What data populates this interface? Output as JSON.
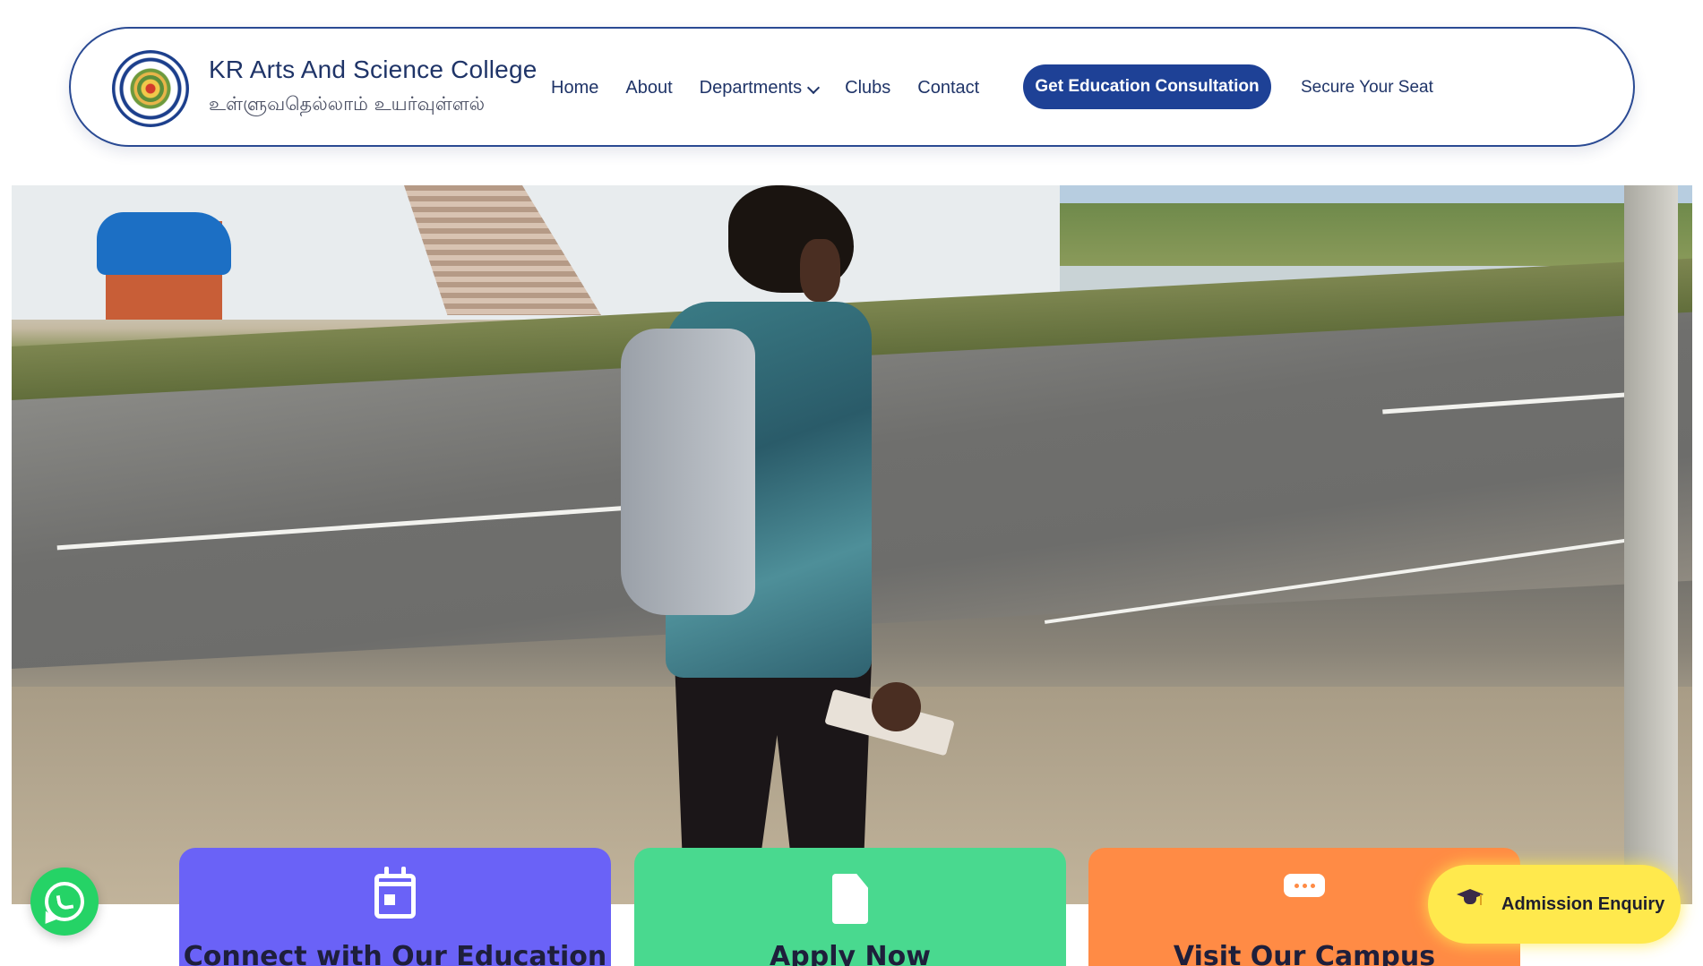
{
  "header": {
    "college_name": "KR Arts And Science College",
    "tagline": "உள்ளுவதெல்லாம் உயர்வுள்ளல்",
    "logo_icon": "college-seal-icon",
    "nav": [
      {
        "label": "Home"
      },
      {
        "label": "About"
      },
      {
        "label": "Departments",
        "has_dropdown": true
      },
      {
        "label": "Clubs"
      },
      {
        "label": "Contact"
      }
    ],
    "cta_label": "Get Education Consultation",
    "secure_label": "Secure Your Seat"
  },
  "hero": {
    "image_description_icon": "student-walking-photo"
  },
  "cards": [
    {
      "title": "Connect with Our Education",
      "icon": "calendar-icon",
      "color": "#6a62f7"
    },
    {
      "title": "Apply Now",
      "icon": "document-icon",
      "color": "#49d98f"
    },
    {
      "title": "Visit Our Campus",
      "icon": "chat-icon",
      "color": "#ff8b45"
    }
  ],
  "widgets": {
    "whatsapp_icon": "whatsapp-icon",
    "enquiry_label": "Admission Enquiry",
    "enquiry_icon": "graduation-cap-icon"
  },
  "colors": {
    "brand_blue": "#1e4196",
    "whatsapp_green": "#25d366",
    "enquiry_yellow": "#ffe94d"
  }
}
